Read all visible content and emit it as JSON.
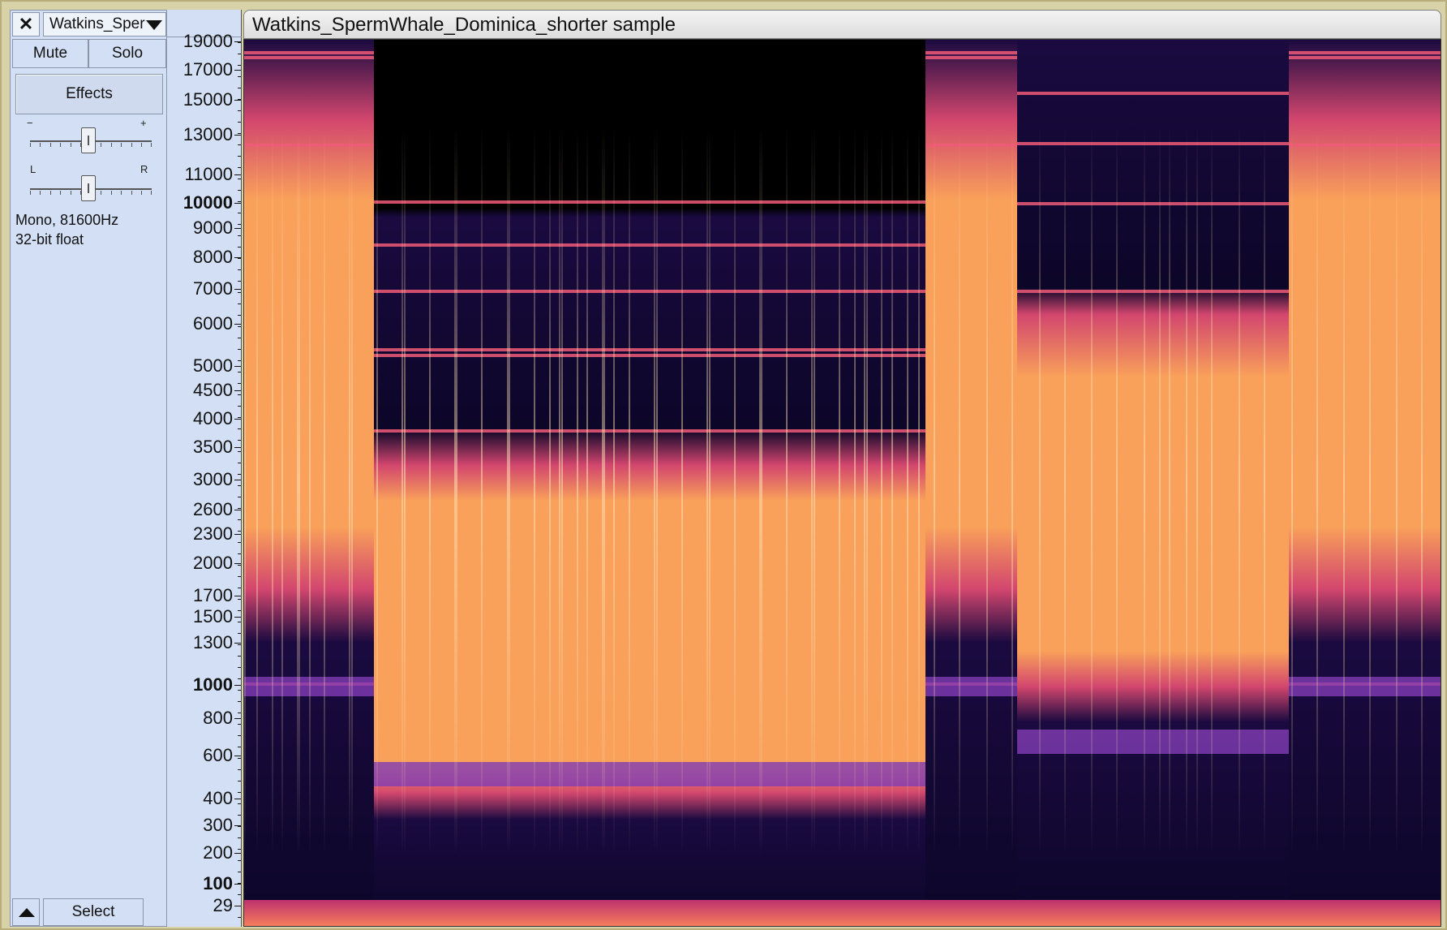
{
  "track": {
    "close_glyph": "✕",
    "name": "Watkins_Sper",
    "title": "Watkins_SpermWhale_Dominica_shorter sample",
    "mute_label": "Mute",
    "solo_label": "Solo",
    "effects_label": "Effects",
    "gain_minus": "−",
    "gain_plus": "+",
    "pan_left": "L",
    "pan_right": "R",
    "format_line1": "Mono, 81600Hz",
    "format_line2": "32-bit float",
    "select_label": "Select"
  },
  "ruler": {
    "labels": [
      "19000",
      "17000",
      "15000",
      "13000",
      "11000",
      "10000",
      "9000",
      "8000",
      "7000",
      "6000",
      "5000",
      "4500",
      "4000",
      "3500",
      "3000",
      "2600",
      "2300",
      "2000",
      "1700",
      "1500",
      "1300",
      "1000",
      "800",
      "600",
      "400",
      "300",
      "200",
      "100",
      "29"
    ],
    "bold_labels": [
      "10000",
      "1000",
      "100"
    ]
  },
  "icons": {
    "close": "close-icon",
    "track_menu": "dropdown-arrow-icon",
    "collapse": "collapse-arrow-icon"
  },
  "colors": {
    "panel": "#d3dff4",
    "spectrogram_hot": "#f9a05a",
    "spectrogram_mid": "#c0307a",
    "spectrogram_cold": "#1a0a40"
  }
}
